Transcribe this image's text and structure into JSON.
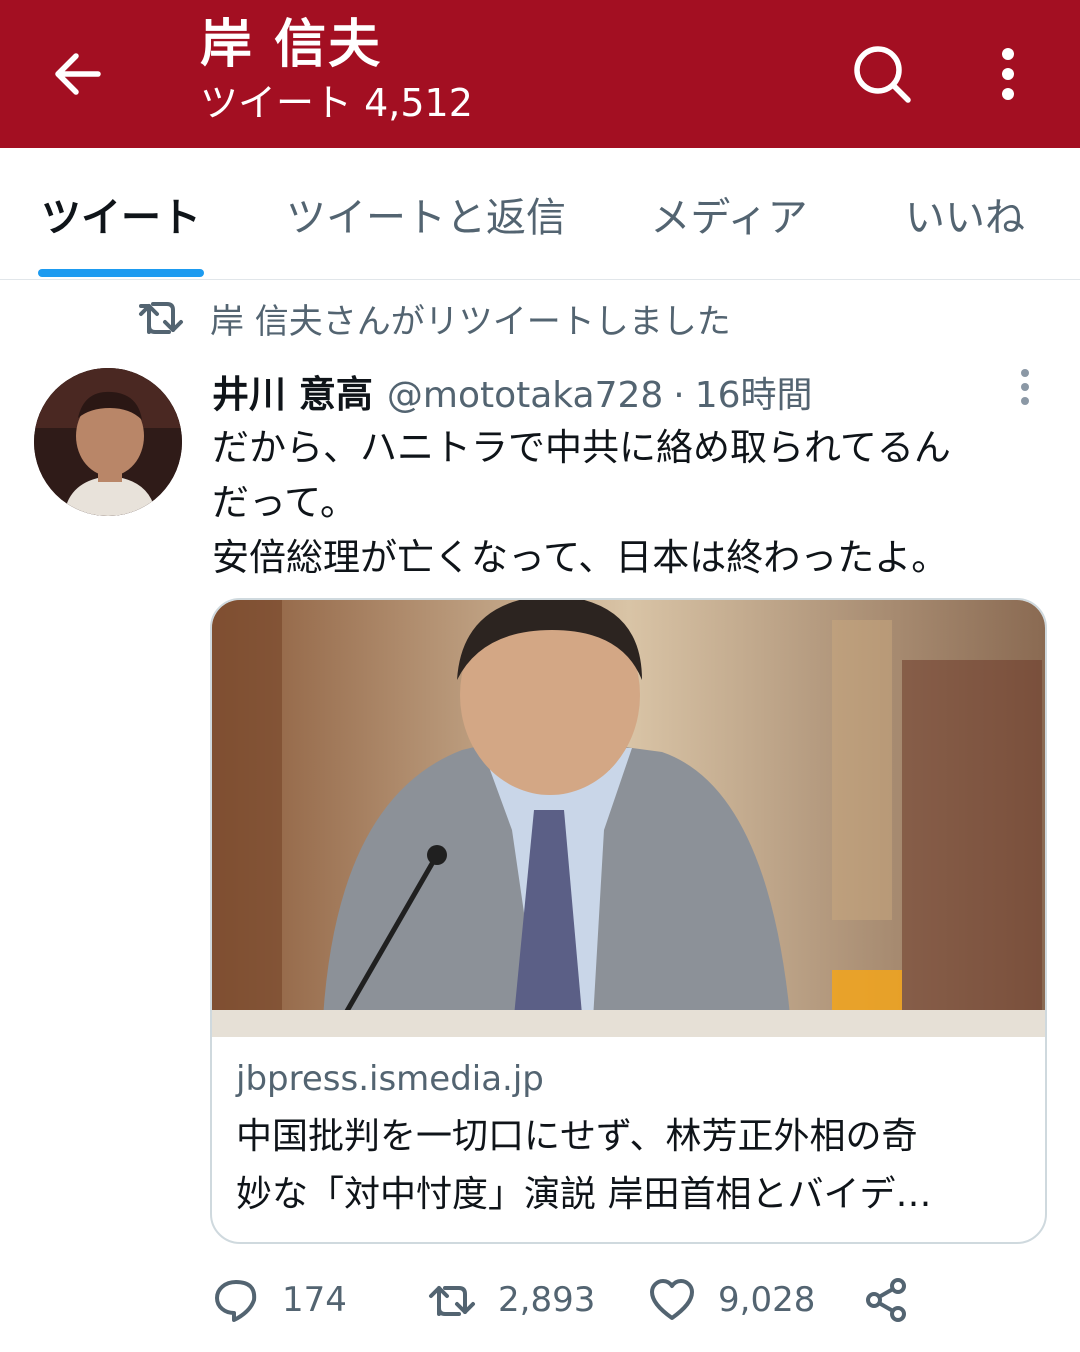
{
  "header": {
    "title": "岸 信夫",
    "subtitle": "ツイート 4,512",
    "back_icon": "arrow-left-icon",
    "search_icon": "search-icon",
    "more_icon": "more-vertical-icon",
    "background_color": "#a30f22"
  },
  "tabs": [
    {
      "label": "ツイート",
      "active": true
    },
    {
      "label": "ツイートと返信",
      "active": false
    },
    {
      "label": "メディア",
      "active": false
    },
    {
      "label": "いいね",
      "active": false
    }
  ],
  "retweet_context": {
    "icon": "retweet-icon",
    "text": "岸 信夫さんがリツイートしました"
  },
  "tweet": {
    "author_name": "井川 意高",
    "author_handle": "@mototaka728",
    "separator": "·",
    "time": "16時間",
    "lines": [
      "だから、ハニトラで中共に絡め取られてるん",
      "だって。",
      "安倍総理が亡くなって、日本は終わったよ。"
    ]
  },
  "card": {
    "domain": "jbpress.ismedia.jp",
    "title_lines": [
      "中国批判を一切口にせず、林芳正外相の奇",
      "妙な「対中忖度」演説 岸田首相とバイデ…"
    ]
  },
  "actions": {
    "reply_count": "174",
    "retweet_count": "2,893",
    "like_count": "9,028"
  },
  "colors": {
    "accent_blue": "#1d9bf0",
    "muted_text": "#536471",
    "header_red": "#a30f22"
  }
}
